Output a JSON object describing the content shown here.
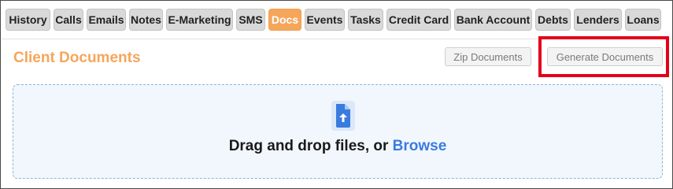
{
  "tabs": [
    {
      "label": "History"
    },
    {
      "label": "Calls"
    },
    {
      "label": "Emails"
    },
    {
      "label": "Notes"
    },
    {
      "label": "E-Marketing"
    },
    {
      "label": "SMS"
    },
    {
      "label": "Docs",
      "active": true
    },
    {
      "label": "Events"
    },
    {
      "label": "Tasks"
    },
    {
      "label": "Credit Card"
    },
    {
      "label": "Bank Account"
    },
    {
      "label": "Debts"
    },
    {
      "label": "Lenders"
    },
    {
      "label": "Loans"
    }
  ],
  "section": {
    "title": "Client Documents",
    "zip_button": "Zip Documents",
    "generate_button": "Generate Documents"
  },
  "dropzone": {
    "text": "Drag and drop files, or",
    "link": "Browse",
    "icon": "file-upload-icon"
  },
  "colors": {
    "accent": "#f5a65b",
    "highlight": "#e3001b",
    "link": "#3a7be0"
  }
}
